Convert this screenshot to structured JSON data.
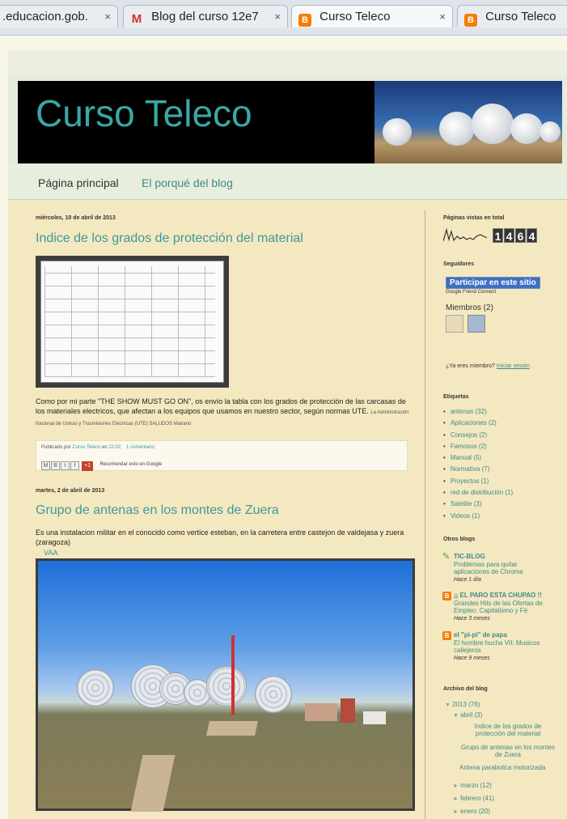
{
  "browser": {
    "tabs": [
      {
        "label": ".educacion.gob.",
        "favicon": "none",
        "active": false
      },
      {
        "label": "Blog del curso 12e7",
        "favicon": "gmail-icon",
        "active": false
      },
      {
        "label": "Curso Teleco",
        "favicon": "blogger-icon",
        "active": true
      },
      {
        "label": "Curso Teleco",
        "favicon": "blogger-icon",
        "active": false
      }
    ],
    "close_glyph": "×"
  },
  "blog": {
    "title": "Curso Teleco",
    "nav": [
      "Página principal",
      "El porqué del blog"
    ]
  },
  "posts": [
    {
      "date": "miércoles, 10 de abril de 2013",
      "title": "Indice de los grados de protección del material",
      "body": "Como por mi parte \"THE SHOW MUST GO ON\", os envío la tabla con los grados de protección de las carcasas de los materiales electricos, que afectan a los equipos que usamos en nuestro sector, según normas UTE.",
      "note": "La Administración Nacional de Usinas y Trasmisiones Eléctricas (UTE) SALUDOS Mariano",
      "footer_prefix": "Publicado por",
      "author": "Curso Teleco",
      "footer_en": "en",
      "time": "22:02",
      "comments": "1 comentario:",
      "share_plus": "+1",
      "share_text": "Recomendar esto en Google"
    },
    {
      "date": "martes, 2 de abril de 2013",
      "title": "Grupo de antenas en los montes de Zuera",
      "body": "Es una instalacion militar en el conocido como vertice esteban, en la carretera entre castejon de valdejasa y zuera (zaragoza)",
      "link": "VAA"
    }
  ],
  "sidebar": {
    "pageviews_title": "Páginas vistas en total",
    "pageviews_digits": [
      "1",
      "4",
      "6",
      "4"
    ],
    "followers_title": "Seguidores",
    "follow_button": "Participar en este sitio",
    "gfc_label": "Google Friend Connect",
    "members_label": "Miembros (2)",
    "already_member": "¿Ya eres miembro?",
    "login_link": "Iniciar sesión",
    "labels_title": "Etiquetas",
    "labels": [
      "antenas (32)",
      "Aplicaciones (2)",
      "Consejos (2)",
      "Famosos (2)",
      "Manual (5)",
      "Normativa (7)",
      "Proyectos (1)",
      "red de distribución (1)",
      "Satélite (3)",
      "Videos (1)"
    ],
    "other_blogs_title": "Otros blogs",
    "other_blogs": [
      {
        "name": "TIC-BLOG",
        "post": "Problemas para quitar aplicaciones de Chrome",
        "ago": "Hace 1 día",
        "icon": "leaf-icon"
      },
      {
        "name": "¡¡ EL PARO ESTA CHUPAO !!",
        "post": "Grandes Hits de las Ofertas de Empleo: Capitalismo y Fé",
        "ago": "Hace 3 meses",
        "icon": "blogger-icon"
      },
      {
        "name": "el \"pi-pi\" de papa",
        "post": "El hombre hucha VII: Musicos callejeros",
        "ago": "Hace 9 meses",
        "icon": "blogger-icon"
      }
    ],
    "archive_title": "Archivo del blog",
    "archive": {
      "year": "2013 (76)",
      "month_open": "abril (3)",
      "posts": [
        "Indice de los grados de protección del material",
        "Grupo de antenas en los montes de Zuera",
        "Antena parabolica motorizada"
      ],
      "months": [
        "marzo (12)",
        "febrero (41)",
        "enero (20)"
      ]
    }
  },
  "colors": {
    "title": "#3aa7a6",
    "link": "#3b8b8a",
    "background": "#f4e8c0",
    "blogger": "#f57d00"
  }
}
